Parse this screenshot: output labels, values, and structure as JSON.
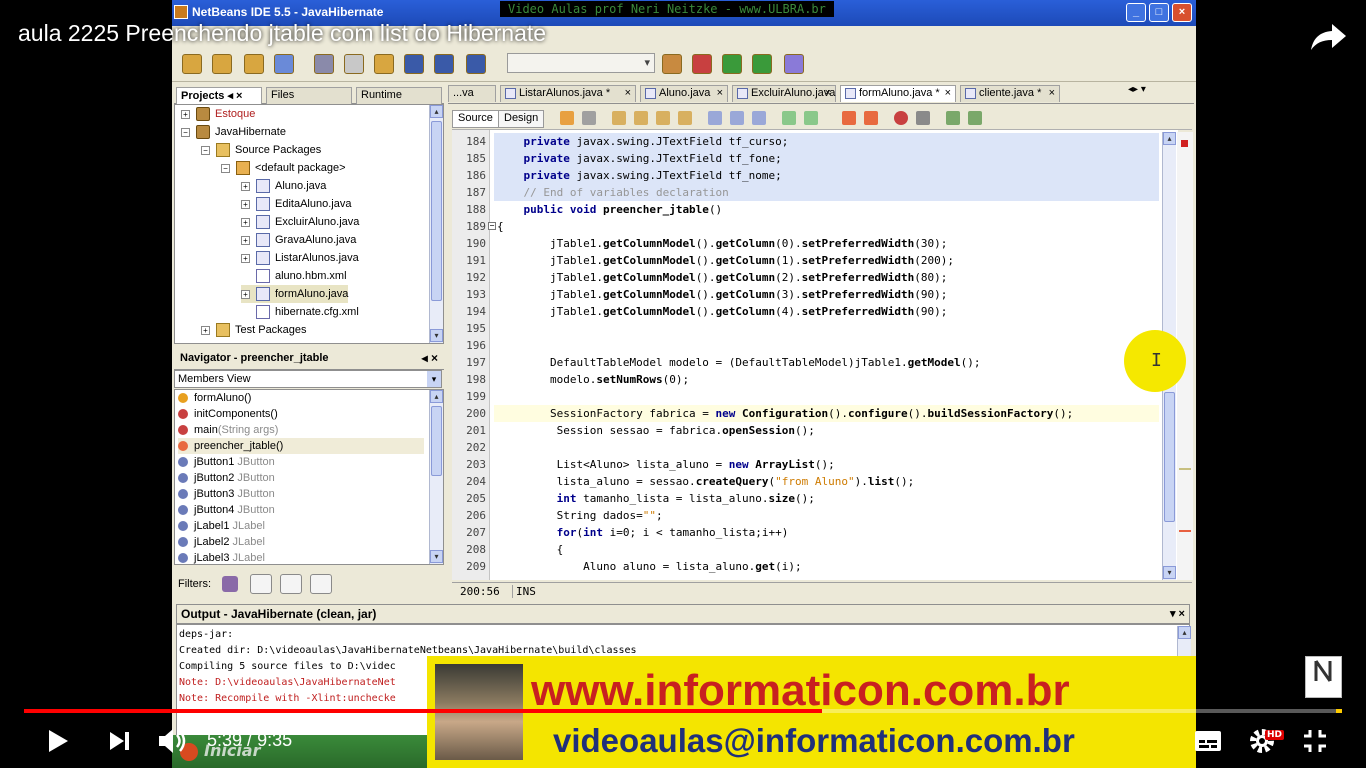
{
  "video": {
    "title": "aula 2225 Preenchendo jtable com list do Hibernate",
    "current_time": "5:39",
    "separator": " / ",
    "duration": "9:35",
    "progress_fraction": 0.6052,
    "hd_badge": "HD"
  },
  "window": {
    "title": "NetBeans IDE 5.5 - JavaHibernate",
    "banner": "Video Aulas prof Neri Neitzke - www.ULBRA.br"
  },
  "projects_panel": {
    "tabs": [
      "Projects",
      "Files",
      "Runtime"
    ],
    "tree": [
      {
        "label": "Estoque",
        "level": 0,
        "toggle": "+",
        "icon": "proj",
        "color": "#b02020"
      },
      {
        "label": "JavaHibernate",
        "level": 0,
        "toggle": "−",
        "icon": "proj"
      },
      {
        "label": "Source Packages",
        "level": 1,
        "toggle": "−",
        "icon": "folder"
      },
      {
        "label": "<default package>",
        "level": 2,
        "toggle": "−",
        "icon": "pkg"
      },
      {
        "label": "Aluno.java",
        "level": 3,
        "toggle": "+",
        "icon": "java"
      },
      {
        "label": "EditaAluno.java",
        "level": 3,
        "toggle": "+",
        "icon": "java"
      },
      {
        "label": "ExcluirAluno.java",
        "level": 3,
        "toggle": "+",
        "icon": "java"
      },
      {
        "label": "GravaAluno.java",
        "level": 3,
        "toggle": "+",
        "icon": "java"
      },
      {
        "label": "ListarAlunos.java",
        "level": 3,
        "toggle": "+",
        "icon": "java"
      },
      {
        "label": "aluno.hbm.xml",
        "level": 3,
        "toggle": "",
        "icon": "xml"
      },
      {
        "label": "formAluno.java",
        "level": 3,
        "toggle": "+",
        "icon": "java",
        "selected": true
      },
      {
        "label": "hibernate.cfg.xml",
        "level": 3,
        "toggle": "",
        "icon": "xml"
      },
      {
        "label": "Test Packages",
        "level": 1,
        "toggle": "+",
        "icon": "folder"
      }
    ]
  },
  "navigator": {
    "title": "Navigator - preencher_jtable",
    "view_select": "Members View",
    "items": [
      {
        "name": "formAluno()",
        "type": "",
        "color": "#e8a020"
      },
      {
        "name": "initComponents()",
        "type": "",
        "color": "#c84040"
      },
      {
        "name": "main",
        "type": "(String args)",
        "color": "#c84040"
      },
      {
        "name": "preencher_jtable()",
        "type": "",
        "color": "#e86a40",
        "selected": true
      },
      {
        "name": "jButton1",
        "type": " JButton",
        "color": "#6a7ab8"
      },
      {
        "name": "jButton2",
        "type": " JButton",
        "color": "#6a7ab8"
      },
      {
        "name": "jButton3",
        "type": " JButton",
        "color": "#6a7ab8"
      },
      {
        "name": "jButton4",
        "type": " JButton",
        "color": "#6a7ab8"
      },
      {
        "name": "jLabel1",
        "type": " JLabel",
        "color": "#6a7ab8"
      },
      {
        "name": "jLabel2",
        "type": " JLabel",
        "color": "#6a7ab8"
      },
      {
        "name": "jLabel3",
        "type": " JLabel",
        "color": "#6a7ab8"
      }
    ],
    "filters_label": "Filters:"
  },
  "editor": {
    "tabs": [
      {
        "label": "...va",
        "active": false
      },
      {
        "label": "ListarAlunos.java *",
        "active": false
      },
      {
        "label": "Aluno.java",
        "active": false
      },
      {
        "label": "ExcluirAluno.java",
        "active": false
      },
      {
        "label": "formAluno.java *",
        "active": true
      },
      {
        "label": "cliente.java *",
        "active": false
      }
    ],
    "source_label": "Source",
    "design_label": "Design",
    "lines": [
      {
        "n": "184",
        "hl": true,
        "parts": [
          [
            "kw",
            "    private "
          ],
          [
            "",
            "javax.swing.JTextField tf_curso;"
          ]
        ]
      },
      {
        "n": "185",
        "hl": true,
        "parts": [
          [
            "kw",
            "    private "
          ],
          [
            "",
            "javax.swing.JTextField tf_fone;"
          ]
        ]
      },
      {
        "n": "186",
        "hl": true,
        "parts": [
          [
            "kw",
            "    private "
          ],
          [
            "",
            "javax.swing.JTextField tf_nome;"
          ]
        ]
      },
      {
        "n": "187",
        "hl": true,
        "parts": [
          [
            "cmt",
            "    // End of variables declaration"
          ]
        ]
      },
      {
        "n": "188",
        "parts": [
          [
            "kw",
            "    public void "
          ],
          [
            "meth",
            "preencher_jtable"
          ],
          [
            "",
            "()"
          ]
        ]
      },
      {
        "n": "189",
        "fold": true,
        "parts": [
          [
            "",
            "{"
          ]
        ]
      },
      {
        "n": "190",
        "parts": [
          [
            "",
            "        jTable1."
          ],
          [
            "meth",
            "getColumnModel"
          ],
          [
            "",
            "()."
          ],
          [
            "meth",
            "getColumn"
          ],
          [
            "",
            "(0)."
          ],
          [
            "meth",
            "setPreferredWidth"
          ],
          [
            "",
            "(30);"
          ]
        ]
      },
      {
        "n": "191",
        "parts": [
          [
            "",
            "        jTable1."
          ],
          [
            "meth",
            "getColumnModel"
          ],
          [
            "",
            "()."
          ],
          [
            "meth",
            "getColumn"
          ],
          [
            "",
            "(1)."
          ],
          [
            "meth",
            "setPreferredWidth"
          ],
          [
            "",
            "(200);"
          ]
        ]
      },
      {
        "n": "192",
        "parts": [
          [
            "",
            "        jTable1."
          ],
          [
            "meth",
            "getColumnModel"
          ],
          [
            "",
            "()."
          ],
          [
            "meth",
            "getColumn"
          ],
          [
            "",
            "(2)."
          ],
          [
            "meth",
            "setPreferredWidth"
          ],
          [
            "",
            "(80);"
          ]
        ]
      },
      {
        "n": "193",
        "parts": [
          [
            "",
            "        jTable1."
          ],
          [
            "meth",
            "getColumnModel"
          ],
          [
            "",
            "()."
          ],
          [
            "meth",
            "getColumn"
          ],
          [
            "",
            "(3)."
          ],
          [
            "meth",
            "setPreferredWidth"
          ],
          [
            "",
            "(90);"
          ]
        ]
      },
      {
        "n": "194",
        "parts": [
          [
            "",
            "        jTable1."
          ],
          [
            "meth",
            "getColumnModel"
          ],
          [
            "",
            "()."
          ],
          [
            "meth",
            "getColumn"
          ],
          [
            "",
            "(4)."
          ],
          [
            "meth",
            "setPreferredWidth"
          ],
          [
            "",
            "(90);"
          ]
        ]
      },
      {
        "n": "195",
        "parts": []
      },
      {
        "n": "196",
        "parts": []
      },
      {
        "n": "197",
        "parts": [
          [
            "",
            "        DefaultTableModel modelo = (DefaultTableModel)jTable1."
          ],
          [
            "meth",
            "getModel"
          ],
          [
            "",
            "();"
          ]
        ]
      },
      {
        "n": "198",
        "parts": [
          [
            "",
            "        modelo."
          ],
          [
            "meth",
            "setNumRows"
          ],
          [
            "",
            "(0);"
          ]
        ]
      },
      {
        "n": "199",
        "parts": []
      },
      {
        "n": "200",
        "cur": true,
        "parts": [
          [
            "",
            "        SessionFactory fabrica = "
          ],
          [
            "kw",
            "new "
          ],
          [
            "meth",
            "Configuration"
          ],
          [
            "",
            "()."
          ],
          [
            "meth",
            "configure"
          ],
          [
            "",
            "()."
          ],
          [
            "meth",
            "buildSessionFactory"
          ],
          [
            "",
            "();"
          ]
        ]
      },
      {
        "n": "201",
        "parts": [
          [
            "",
            "         Session sessao = fabrica."
          ],
          [
            "meth",
            "openSession"
          ],
          [
            "",
            "();"
          ]
        ]
      },
      {
        "n": "202",
        "parts": []
      },
      {
        "n": "203",
        "parts": [
          [
            "",
            "         List<Aluno> lista_aluno = "
          ],
          [
            "kw",
            "new "
          ],
          [
            "meth",
            "ArrayList"
          ],
          [
            "",
            "();"
          ]
        ]
      },
      {
        "n": "204",
        "parts": [
          [
            "",
            "         lista_aluno = sessao."
          ],
          [
            "meth",
            "createQuery"
          ],
          [
            "",
            "("
          ],
          [
            "str",
            "\"from Aluno\""
          ],
          [
            "",
            ")."
          ],
          [
            "meth",
            "list"
          ],
          [
            "",
            "();"
          ]
        ]
      },
      {
        "n": "205",
        "parts": [
          [
            "kw",
            "         int "
          ],
          [
            "",
            "tamanho_lista = lista_aluno."
          ],
          [
            "meth",
            "size"
          ],
          [
            "",
            "();"
          ]
        ]
      },
      {
        "n": "206",
        "parts": [
          [
            "",
            "         String dados="
          ],
          [
            "str",
            "\"\""
          ],
          [
            "",
            ";"
          ]
        ]
      },
      {
        "n": "207",
        "parts": [
          [
            "kw",
            "         for"
          ],
          [
            "",
            "("
          ],
          [
            "kw",
            "int "
          ],
          [
            "",
            "i=0; i < tamanho_lista;i++)"
          ]
        ]
      },
      {
        "n": "208",
        "parts": [
          [
            "",
            "         {"
          ]
        ]
      },
      {
        "n": "209",
        "parts": [
          [
            "",
            "             Aluno aluno = lista_aluno."
          ],
          [
            "meth",
            "get"
          ],
          [
            "",
            "(i);"
          ]
        ]
      }
    ],
    "status_position": "200:56",
    "status_mode": "INS"
  },
  "output": {
    "title": "Output - JavaHibernate (clean, jar)",
    "lines": [
      {
        "text": "deps-jar:",
        "red": false
      },
      {
        "text": "Created dir: D:\\videoaulas\\JavaHibernateNetbeans\\JavaHibernate\\build\\classes",
        "red": false
      },
      {
        "text": "Compiling 5 source files to D:\\videc",
        "red": false
      },
      {
        "text": "Note: D:\\videoaulas\\JavaHibernateNet",
        "red": true
      },
      {
        "text": "Note: Recompile with -Xlint:unchecke",
        "red": true
      }
    ]
  },
  "ad": {
    "main": "www.informaticon.com.br",
    "sub": "videoaulas@informaticon.com.br"
  },
  "taskbar": {
    "start": "Iniciar"
  },
  "colors": {
    "progress": "#ff0000",
    "ad_background": "#f4e500",
    "ad_main_text": "#c82020",
    "ad_sub_text": "#20307a"
  }
}
